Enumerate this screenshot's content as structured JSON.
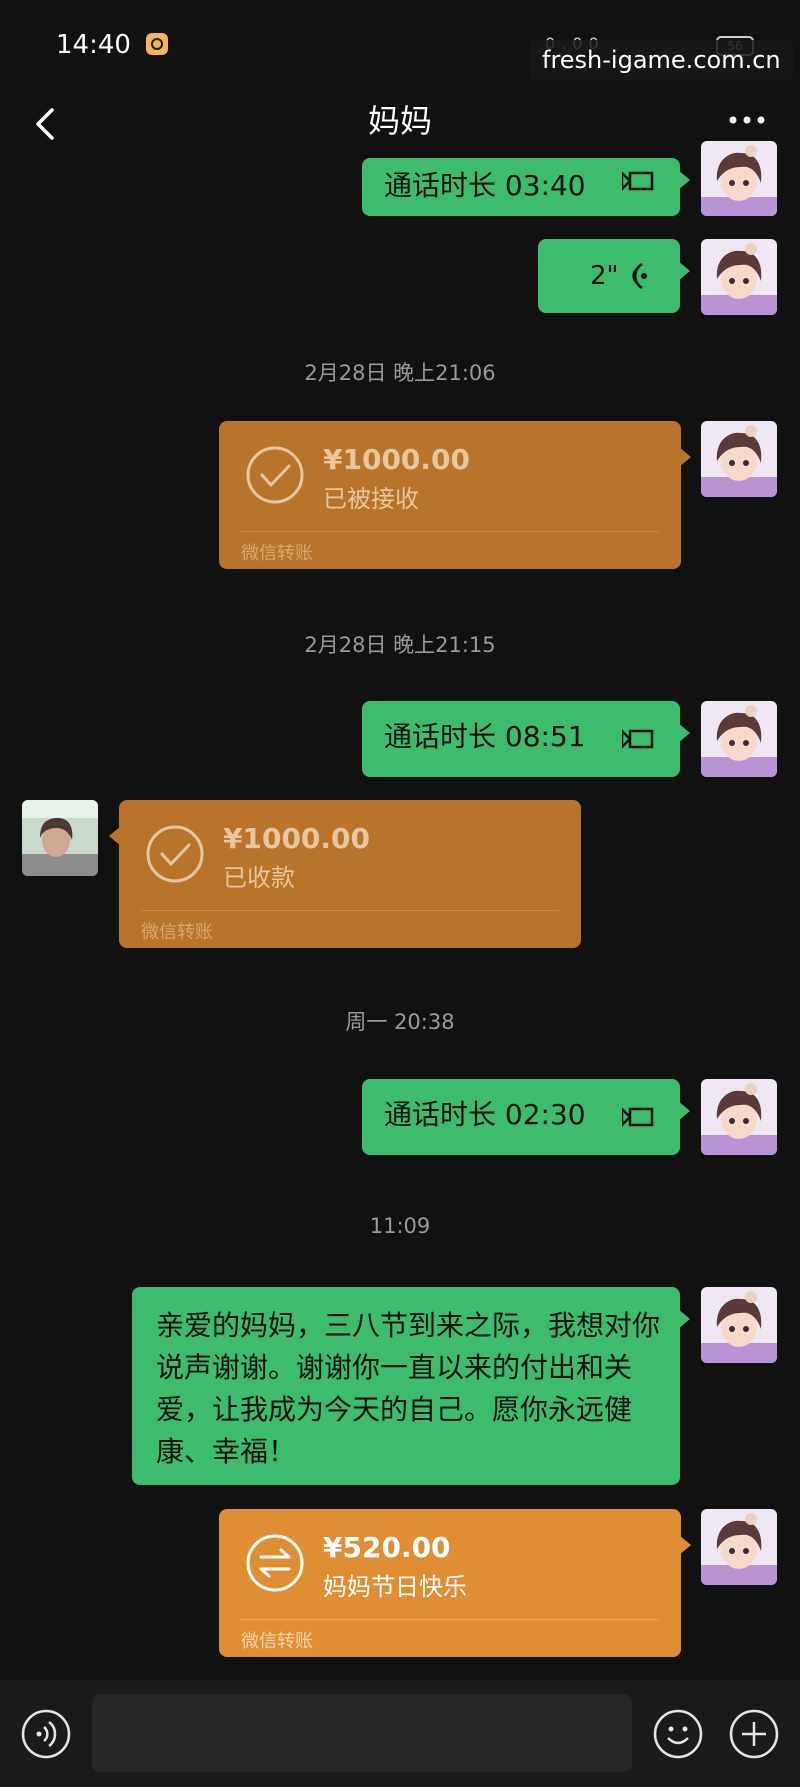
{
  "status_bar": {
    "time": "14:40",
    "network_speed": "0.00",
    "battery": "56"
  },
  "watermark": "fresh-igame.com.cn",
  "header": {
    "title": "妈妈"
  },
  "messages": {
    "call1": "通话时长 03:40",
    "voice1": "2\"",
    "ts1": "2月28日 晚上21:06",
    "transfer1": {
      "amount": "¥1000.00",
      "status": "已被接收",
      "footer": "微信转账"
    },
    "ts2": "2月28日 晚上21:15",
    "call2": "通话时长 08:51",
    "transfer2": {
      "amount": "¥1000.00",
      "status": "已收款",
      "footer": "微信转账"
    },
    "ts3": "周一 20:38",
    "call3": "通话时长 02:30",
    "ts4": "11:09",
    "text1": "亲爱的妈妈，三八节到来之际，我想对你说声谢谢。谢谢你一直以来的付出和关爱，让我成为今天的自己。愿你永远健康、幸福！",
    "transfer3": {
      "amount": "¥520.00",
      "status": "妈妈节日快乐",
      "footer": "微信转账"
    }
  },
  "colors": {
    "background": "#111111",
    "sent_bubble": "#3dbb6e",
    "transfer_received": "#b8742a",
    "transfer_pending": "#e08e34"
  },
  "icons": [
    "back-icon",
    "more-icon",
    "video-call-icon",
    "voice-icon",
    "check-icon",
    "transfer-icon",
    "voice-input-icon",
    "emoji-icon",
    "plus-icon"
  ]
}
